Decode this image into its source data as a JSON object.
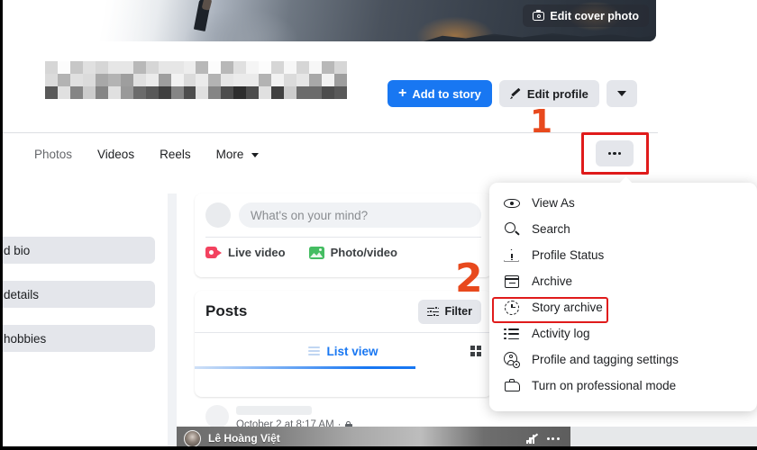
{
  "cover": {
    "edit_button_label": "Edit cover photo",
    "edit_button_icon": "camera-icon"
  },
  "profile": {
    "name_redacted": true,
    "actions": {
      "add_to_story_label": "Add to story",
      "edit_profile_label": "Edit profile",
      "more_caret_icon": "chevron-down-icon"
    }
  },
  "nav": {
    "tabs": [
      {
        "label": "Photos",
        "active": false
      },
      {
        "label": "Videos",
        "active": false
      },
      {
        "label": "Reels",
        "active": false
      },
      {
        "label": "More",
        "active": false,
        "has_caret": true
      }
    ],
    "more_options_icon": "ellipsis-horizontal-icon"
  },
  "annotations": [
    {
      "number": "1",
      "target": "more-options-button",
      "color": "#e8491d"
    },
    {
      "number": "2",
      "target": "story-archive-menu-item",
      "color": "#e8491d"
    }
  ],
  "highlight_color": "#e01b1b",
  "sidebar": {
    "cards": [
      {
        "label": "d bio"
      },
      {
        "label": "details"
      },
      {
        "label": "hobbies"
      }
    ]
  },
  "composer": {
    "placeholder": "What's on your mind?",
    "actions": [
      {
        "label": "Live video",
        "icon": "live-video-icon"
      },
      {
        "label": "Photo/video",
        "icon": "photo-video-icon"
      }
    ]
  },
  "posts": {
    "title": "Posts",
    "filter_label": "Filter",
    "filter_icon": "sliders-icon",
    "manage_posts_icon": "ellipsis-horizontal-icon",
    "list_view_label": "List view",
    "list_view_icon": "list-icon",
    "grid_view_icon": "grid-icon",
    "item": {
      "timestamp": "October 2 at 8:17 AM",
      "separator": "·",
      "privacy_icon": "lock-icon"
    }
  },
  "menu": {
    "items": [
      {
        "label": "View As",
        "icon": "eye-icon",
        "highlighted": false
      },
      {
        "label": "Search",
        "icon": "search-icon",
        "highlighted": false
      },
      {
        "label": "Profile Status",
        "icon": "warning-triangle-icon",
        "highlighted": false
      },
      {
        "label": "Archive",
        "icon": "archive-box-icon",
        "highlighted": false
      },
      {
        "label": "Story archive",
        "icon": "clock-history-icon",
        "highlighted": true
      },
      {
        "label": "Activity log",
        "icon": "list-bullet-icon",
        "highlighted": false
      },
      {
        "label": "Profile and tagging settings",
        "icon": "profile-gear-icon",
        "highlighted": false
      },
      {
        "label": "Turn on professional mode",
        "icon": "briefcase-icon",
        "highlighted": false
      }
    ]
  },
  "video_overlay": {
    "author": "Lê Hoàng Việt",
    "volume_icon": "volume-muted-icon",
    "options_icon": "ellipsis-horizontal-icon"
  },
  "colors": {
    "facebook_blue": "#1877f2",
    "button_gray": "#e4e6eb",
    "annotation_orange": "#e8491d",
    "highlight_red": "#e01b1b"
  }
}
